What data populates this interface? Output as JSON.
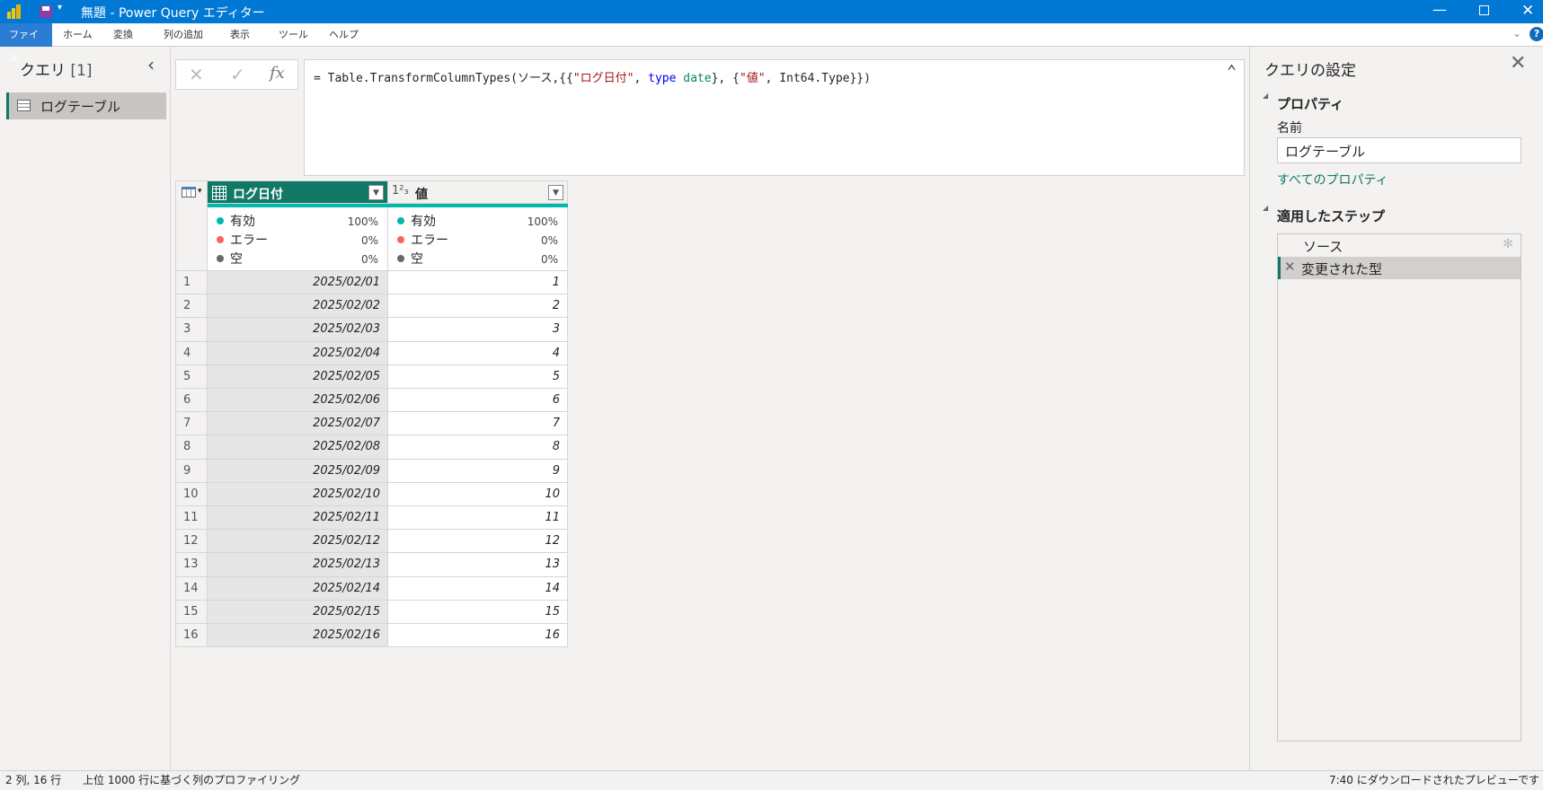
{
  "window": {
    "title": "無題 - Power Query エディター"
  },
  "menu": [
    "ファイル",
    "ホーム",
    "変換",
    "列の追加",
    "表示",
    "ツール",
    "ヘルプ"
  ],
  "queries": {
    "title": "クエリ",
    "count": "[1]",
    "items": [
      "ログテーブル"
    ]
  },
  "formula": {
    "prefix": "= Table.TransformColumnTypes(ソース,{{",
    "s1": "\"ログ日付\"",
    "c1": ", ",
    "kw1": "type",
    "sp": " ",
    "kw2": "date",
    "c2": "}, {",
    "s2": "\"値\"",
    "c3": ", Int64.Type}})"
  },
  "columns": [
    {
      "name": "ログ日付",
      "type_icon": "calendar-icon",
      "valid": "100%",
      "error": "0%",
      "empty": "0%"
    },
    {
      "name": "値",
      "type_icon": "1²₃",
      "valid": "100%",
      "error": "0%",
      "empty": "0%"
    }
  ],
  "profile_labels": {
    "valid": "有効",
    "error": "エラー",
    "empty": "空"
  },
  "colors": {
    "valid": "#01b8aa",
    "error": "#fd625e",
    "empty": "#5f6b6d",
    "accent": "#117865"
  },
  "rows": [
    [
      "1",
      "2025/02/01",
      "1"
    ],
    [
      "2",
      "2025/02/02",
      "2"
    ],
    [
      "3",
      "2025/02/03",
      "3"
    ],
    [
      "4",
      "2025/02/04",
      "4"
    ],
    [
      "5",
      "2025/02/05",
      "5"
    ],
    [
      "6",
      "2025/02/06",
      "6"
    ],
    [
      "7",
      "2025/02/07",
      "7"
    ],
    [
      "8",
      "2025/02/08",
      "8"
    ],
    [
      "9",
      "2025/02/09",
      "9"
    ],
    [
      "10",
      "2025/02/10",
      "10"
    ],
    [
      "11",
      "2025/02/11",
      "11"
    ],
    [
      "12",
      "2025/02/12",
      "12"
    ],
    [
      "13",
      "2025/02/13",
      "13"
    ],
    [
      "14",
      "2025/02/14",
      "14"
    ],
    [
      "15",
      "2025/02/15",
      "15"
    ],
    [
      "16",
      "2025/02/16",
      "16"
    ]
  ],
  "settings": {
    "title": "クエリの設定",
    "properties": "プロパティ",
    "name_label": "名前",
    "name_value": "ログテーブル",
    "all_props": "すべてのプロパティ",
    "steps_title": "適用したステップ",
    "steps": [
      "ソース",
      "変更された型"
    ]
  },
  "status": {
    "left1": "2 列, 16 行",
    "left2": "上位 1000 行に基づく列のプロファイリング",
    "right": "7:40 にダウンロードされたプレビューです"
  }
}
